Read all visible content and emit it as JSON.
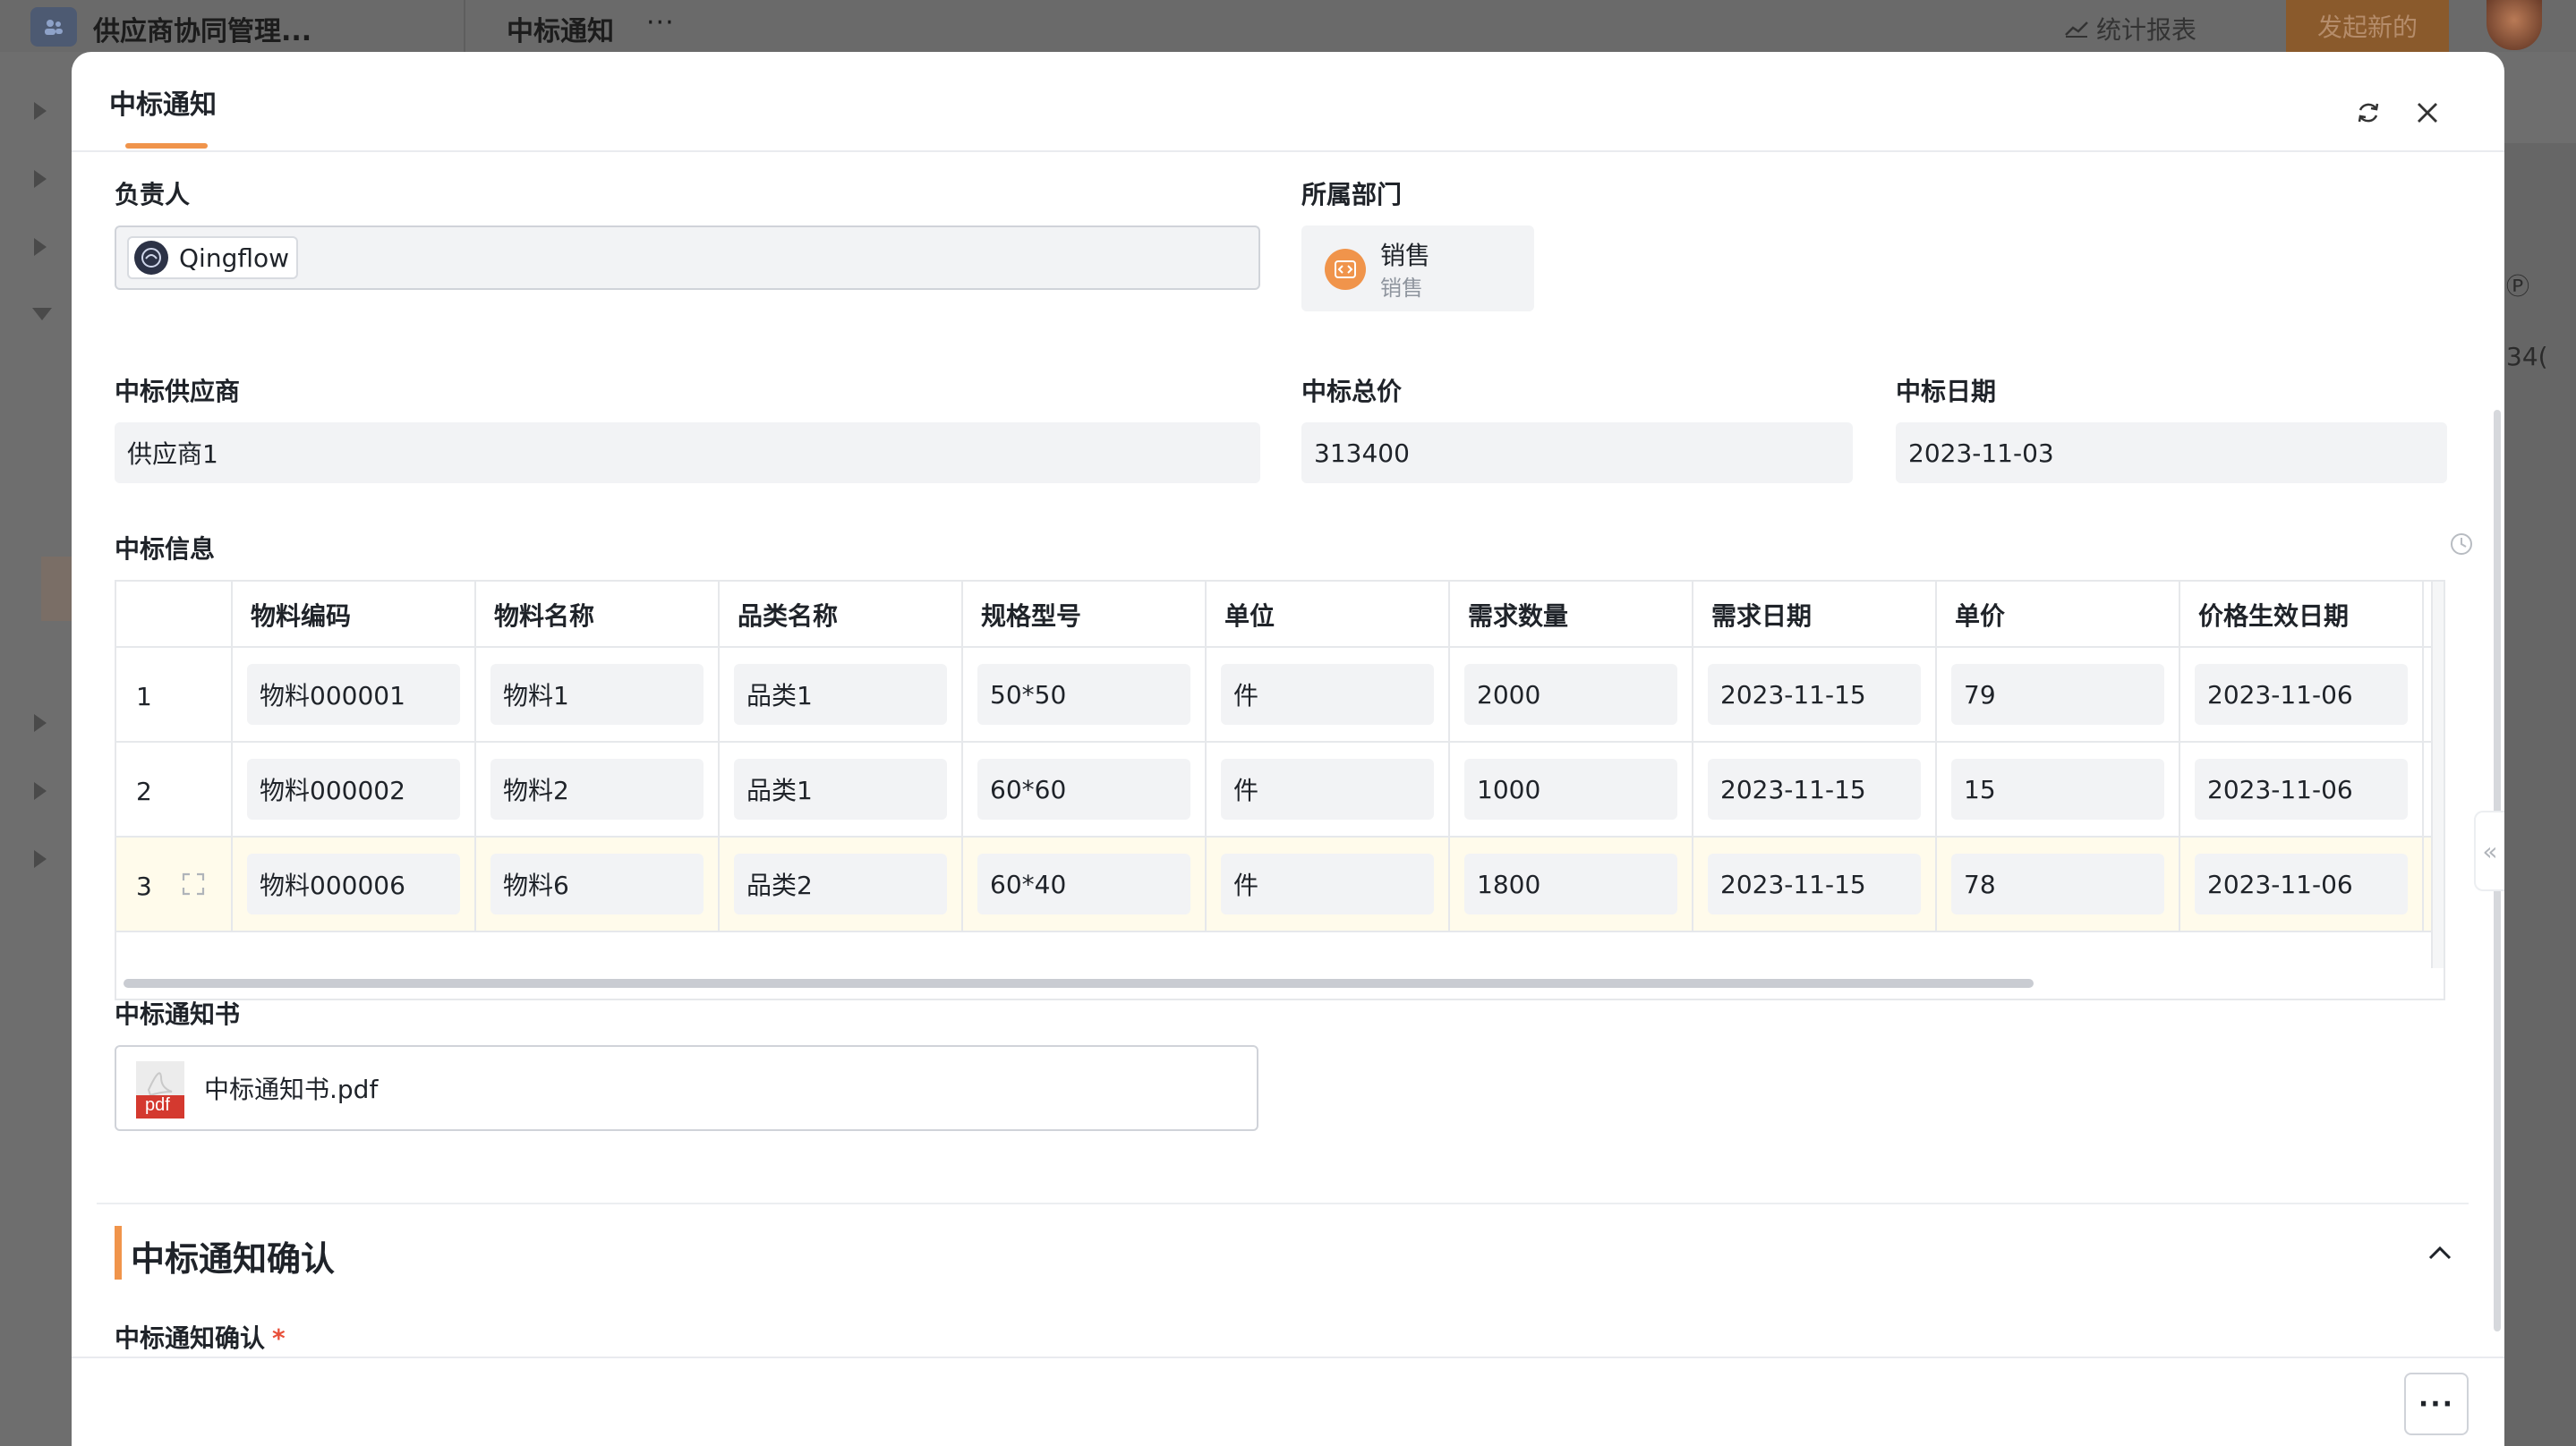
{
  "background": {
    "app_name": "供应商协同管理...",
    "breadcrumb": "中标通知",
    "more": "···",
    "report_label": "统计报表",
    "new_button": "发起新的",
    "right_text_1": "Ⓟ",
    "right_text_2": "34("
  },
  "modal": {
    "title": "中标通知",
    "owner_label": "负责人",
    "owner_value": "Qingflow",
    "dept_label": "所属部门",
    "dept_name": "销售",
    "dept_sub": "销售",
    "supplier_label": "中标供应商",
    "supplier_value": "供应商1",
    "total_label": "中标总价",
    "total_value": "313400",
    "date_label": "中标日期",
    "date_value": "2023-11-03",
    "info_label": "中标信息",
    "table": {
      "columns": [
        "",
        "物料编码",
        "物料名称",
        "品类名称",
        "规格型号",
        "单位",
        "需求数量",
        "需求日期",
        "单价",
        "价格生效日期"
      ],
      "rows": [
        [
          "1",
          "物料000001",
          "物料1",
          "品类1",
          "50*50",
          "件",
          "2000",
          "2023-11-15",
          "79",
          "2023-11-06"
        ],
        [
          "2",
          "物料000002",
          "物料2",
          "品类1",
          "60*60",
          "件",
          "1000",
          "2023-11-15",
          "15",
          "2023-11-06"
        ],
        [
          "3",
          "物料000006",
          "物料6",
          "品类2",
          "60*40",
          "件",
          "1800",
          "2023-11-15",
          "78",
          "2023-11-06"
        ]
      ]
    },
    "notice_label": "中标通知书",
    "file_name": "中标通知书.pdf",
    "pdf_badge": "pdf",
    "section_title": "中标通知确认",
    "confirm_label": "中标通知确认",
    "required_mark": "*",
    "footer_more": "···",
    "side_tab": "«"
  },
  "colors": {
    "accent": "#f0944b",
    "field_bg": "#f2f3f5",
    "highlight_row": "#fffbeb",
    "required": "#e8503a"
  }
}
